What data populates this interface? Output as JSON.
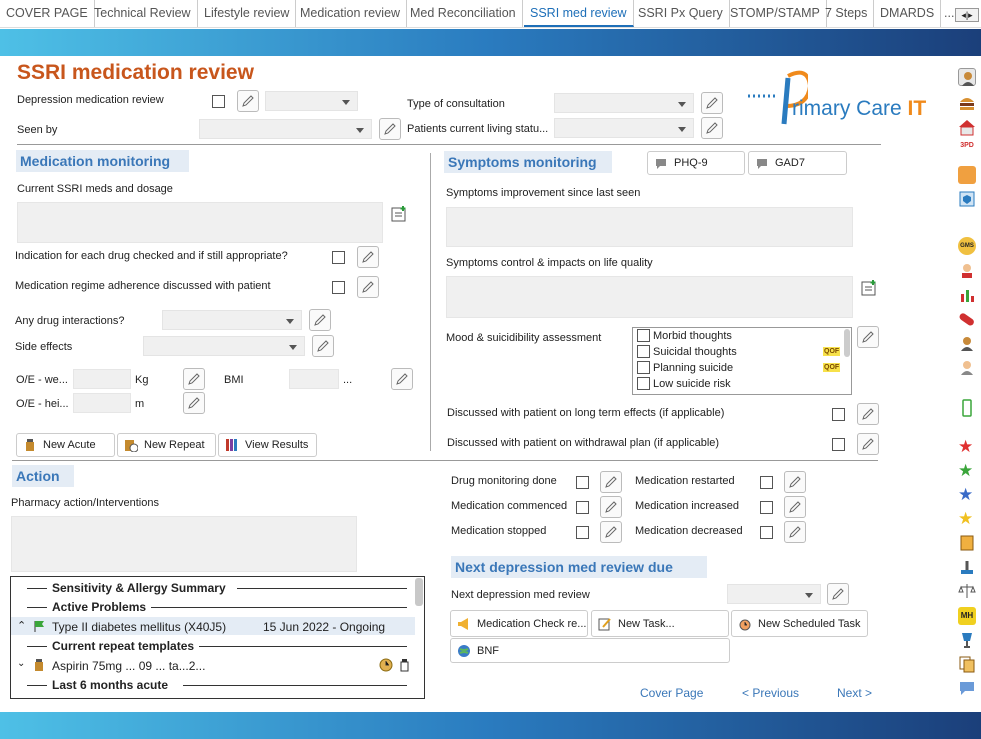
{
  "tabs": [
    "COVER PAGE",
    "Technical Review",
    "Lifestyle review",
    "Medication review",
    "Med Reconciliation",
    "SSRI med review",
    "SSRI Px Query",
    "STOMP/STAMP",
    "7 Steps",
    "DMARDS",
    "..."
  ],
  "active_tab": 5,
  "title": "SSRI medication review",
  "logo": {
    "text_prefix": "rimary Care ",
    "text_suffix": "IT"
  },
  "top": {
    "depression_label": "Depression medication review",
    "seen_by_label": "Seen by",
    "consult_label": "Type of consultation",
    "living_label": "Patients current living statu..."
  },
  "med_monitoring": {
    "title": "Medication monitoring",
    "current_label": "Current SSRI meds and dosage",
    "indication_label": "Indication for each drug checked and if still appropriate?",
    "adherence_label": "Medication regime adherence discussed with patient",
    "interactions_label": "Any drug interactions?",
    "side_effects_label": "Side effects",
    "weight_label": "O/E - we...",
    "weight_unit": "Kg",
    "height_label": "O/E - hei...",
    "height_unit": "m",
    "bmi_label": "BMI",
    "bmi_suffix": "..."
  },
  "buttons": {
    "new_acute": "New Acute",
    "new_repeat": "New Repeat",
    "view_results": "View Results"
  },
  "symptoms": {
    "title": "Symptoms monitoring",
    "phq9": "PHQ-9",
    "gad7": "GAD7",
    "improvement_label": "Symptoms improvement since last seen",
    "control_label": "Symptoms control & impacts on life quality",
    "mood_label": "Mood & suicidibility assessment",
    "mood_items": [
      {
        "text": "Morbid thoughts",
        "qof": ""
      },
      {
        "text": "Suicidal thoughts",
        "qof": "QOF"
      },
      {
        "text": "Planning suicide",
        "qof": "QOF"
      },
      {
        "text": "Low suicide risk",
        "qof": ""
      }
    ],
    "long_term_label": "Discussed with patient on long term effects (if applicable)",
    "withdrawal_label": "Discussed with patient on withdrawal plan (if applicable)"
  },
  "action": {
    "title": "Action",
    "pharmacy_label": "Pharmacy action/Interventions",
    "drug_monitoring": "Drug monitoring done",
    "med_restarted": "Medication restarted",
    "med_commenced": "Medication commenced",
    "med_increased": "Medication increased",
    "med_stopped": "Medication stopped",
    "med_decreased": "Medication decreased"
  },
  "summary": {
    "sensitivity": "Sensitivity & Allergy Summary",
    "active_problems": "Active Problems",
    "problem_name": "Type II diabetes mellitus (X40J5)",
    "problem_date": "15 Jun 2022 - Ongoing",
    "repeat_templates": "Current repeat templates",
    "repeat_drug": "Aspirin 75mg ... 09 ... ta...2...",
    "last_acute": "Last 6 months acute"
  },
  "next_review": {
    "title": "Next depression med review due",
    "label": "Next depression med review",
    "med_check": "Medication Check re...",
    "new_task": "New Task...",
    "new_scheduled": "New Scheduled Task",
    "bnf": "BNF"
  },
  "nav": {
    "cover": "Cover Page",
    "previous": "< Previous",
    "next": "Next >"
  },
  "sidebar_icons": [
    "user-icon",
    "burger-icon",
    "house-icon",
    "calendar-icon",
    "table-icon",
    "shield-icon",
    "gms-icon",
    "nurse-icon",
    "chart-icon",
    "pill-icon",
    "user-icon-2",
    "doctor-icon",
    "phone-icon",
    "star-red-icon",
    "star-green-icon",
    "star-blue-icon",
    "star-yellow-icon",
    "document-icon",
    "stamp-icon",
    "scales-icon",
    "mh-icon",
    "cup-icon",
    "notes-icon",
    "chat-icon"
  ],
  "sidebar_mh": "MH",
  "sidebar_gms": "GMS",
  "sidebar_3pd": "3PD"
}
